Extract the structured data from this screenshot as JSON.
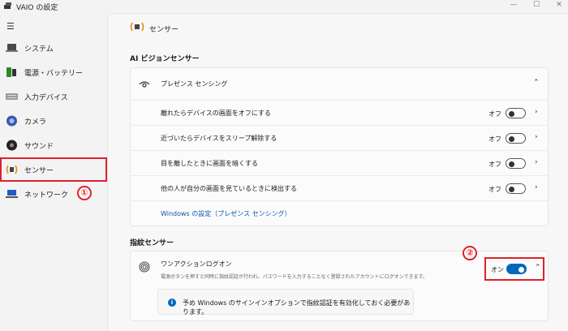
{
  "window": {
    "title": "VAIO の設定",
    "minimize": "—",
    "maximize": "☐",
    "close": "✕"
  },
  "sidebar": {
    "items": [
      {
        "label": "システム",
        "icon": "laptop-icon"
      },
      {
        "label": "電源・バッテリー",
        "icon": "battery-icon"
      },
      {
        "label": "入力デバイス",
        "icon": "keyboard-icon"
      },
      {
        "label": "カメラ",
        "icon": "camera-icon"
      },
      {
        "label": "サウンド",
        "icon": "speaker-icon"
      },
      {
        "label": "センサー",
        "icon": "sensor-icon",
        "selected": true
      },
      {
        "label": "ネットワーク",
        "icon": "network-icon"
      }
    ]
  },
  "page": {
    "title": "センサー"
  },
  "ai_vision": {
    "section_title": "AI ビジョンセンサー",
    "presence_label": "プレゼンス センシング",
    "rows": [
      {
        "label": "離れたらデバイスの画面をオフにする",
        "state": "オフ"
      },
      {
        "label": "近づいたらデバイスをスリープ解除する",
        "state": "オフ"
      },
      {
        "label": "目を離したときに画面を暗くする",
        "state": "オフ"
      },
      {
        "label": "他の人が自分の画面を見ているときに検出する",
        "state": "オフ"
      }
    ],
    "link": "Windows の設定（プレゼンス センシング）"
  },
  "fingerprint": {
    "section_title": "指紋センサー",
    "title": "ワンアクションログオン",
    "description": "電源ボタンを押すと同時に指紋認証が行われ、パスワードを入力することなく登録されたアカウントにログオンできます。",
    "state": "オン",
    "info": "予め Windows のサインインオプションで指紋認証を有効化しておく必要があります。"
  },
  "annotations": {
    "marker1": "①",
    "marker2": "②"
  },
  "colors": {
    "accent": "#0067c0",
    "highlight": "#e0202a"
  }
}
